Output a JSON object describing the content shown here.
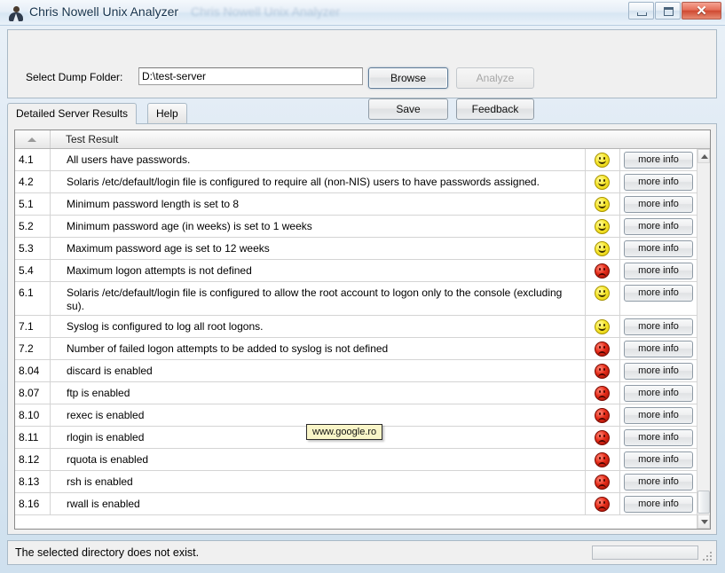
{
  "window": {
    "title": "Chris Nowell Unix Analyzer",
    "ghost_title": "Chris Nowell Unix Analyzer",
    "icon": "person-avatar-icon",
    "controls": {
      "minimize": "minimize-icon",
      "maximize": "maximize-icon",
      "close": "✕"
    }
  },
  "toolbar": {
    "dump_folder_label": "Select Dump Folder:",
    "dump_folder_value": "D:\\test-server",
    "dump_folder_placeholder": "",
    "browse_label": "Browse",
    "analyze_label": "Analyze",
    "save_label": "Save",
    "feedback_label": "Feedback"
  },
  "tabs": [
    {
      "label": "Detailed Server Results",
      "active": true
    },
    {
      "label": "Help",
      "active": false
    }
  ],
  "grid": {
    "columns": [
      "",
      "Test Result"
    ],
    "sort_indicator": "sort-ascending-icon",
    "action_label": "more info",
    "rows": [
      {
        "id": "4.1",
        "text": "All users have passwords.",
        "status": "pass",
        "tall": false
      },
      {
        "id": "4.2",
        "text": "Solaris /etc/default/login file is configured to require all (non-NIS) users to have passwords assigned.",
        "status": "pass",
        "tall": false
      },
      {
        "id": "5.1",
        "text": "Minimum password length is set to 8",
        "status": "pass",
        "tall": false
      },
      {
        "id": "5.2",
        "text": "Minimum password age (in weeks) is set to 1 weeks",
        "status": "pass",
        "tall": false
      },
      {
        "id": "5.3",
        "text": "Maximum password age is set to 12 weeks",
        "status": "pass",
        "tall": false
      },
      {
        "id": "5.4",
        "text": "Maximum logon attempts is not defined",
        "status": "fail",
        "tall": false
      },
      {
        "id": "6.1",
        "text": "Solaris /etc/default/login file is configured to allow the root account to logon only to the console (excluding su).",
        "status": "pass",
        "tall": true
      },
      {
        "id": "7.1",
        "text": "Syslog is configured to log all root logons.",
        "status": "pass",
        "tall": false
      },
      {
        "id": "7.2",
        "text": "Number of failed logon attempts to be added to syslog is not defined",
        "status": "fail",
        "tall": false
      },
      {
        "id": "8.04",
        "text": "discard is enabled",
        "status": "fail",
        "tall": false
      },
      {
        "id": "8.07",
        "text": "ftp is enabled",
        "status": "fail",
        "tall": false
      },
      {
        "id": "8.10",
        "text": "rexec is enabled",
        "status": "fail",
        "tall": false
      },
      {
        "id": "8.11",
        "text": "rlogin is enabled",
        "status": "fail",
        "tall": false
      },
      {
        "id": "8.12",
        "text": "rquota is enabled",
        "status": "fail",
        "tall": false
      },
      {
        "id": "8.13",
        "text": "rsh is enabled",
        "status": "fail",
        "tall": false
      },
      {
        "id": "8.16",
        "text": "rwall is enabled",
        "status": "fail",
        "tall": false
      }
    ]
  },
  "tooltip": {
    "text": "www.google.ro"
  },
  "statusbar": {
    "message": "The selected directory does not exist."
  },
  "colors": {
    "pass": "#f2e014",
    "fail": "#d8230f",
    "window_bg": "#f0f0f0",
    "title_text": "#16334d"
  }
}
